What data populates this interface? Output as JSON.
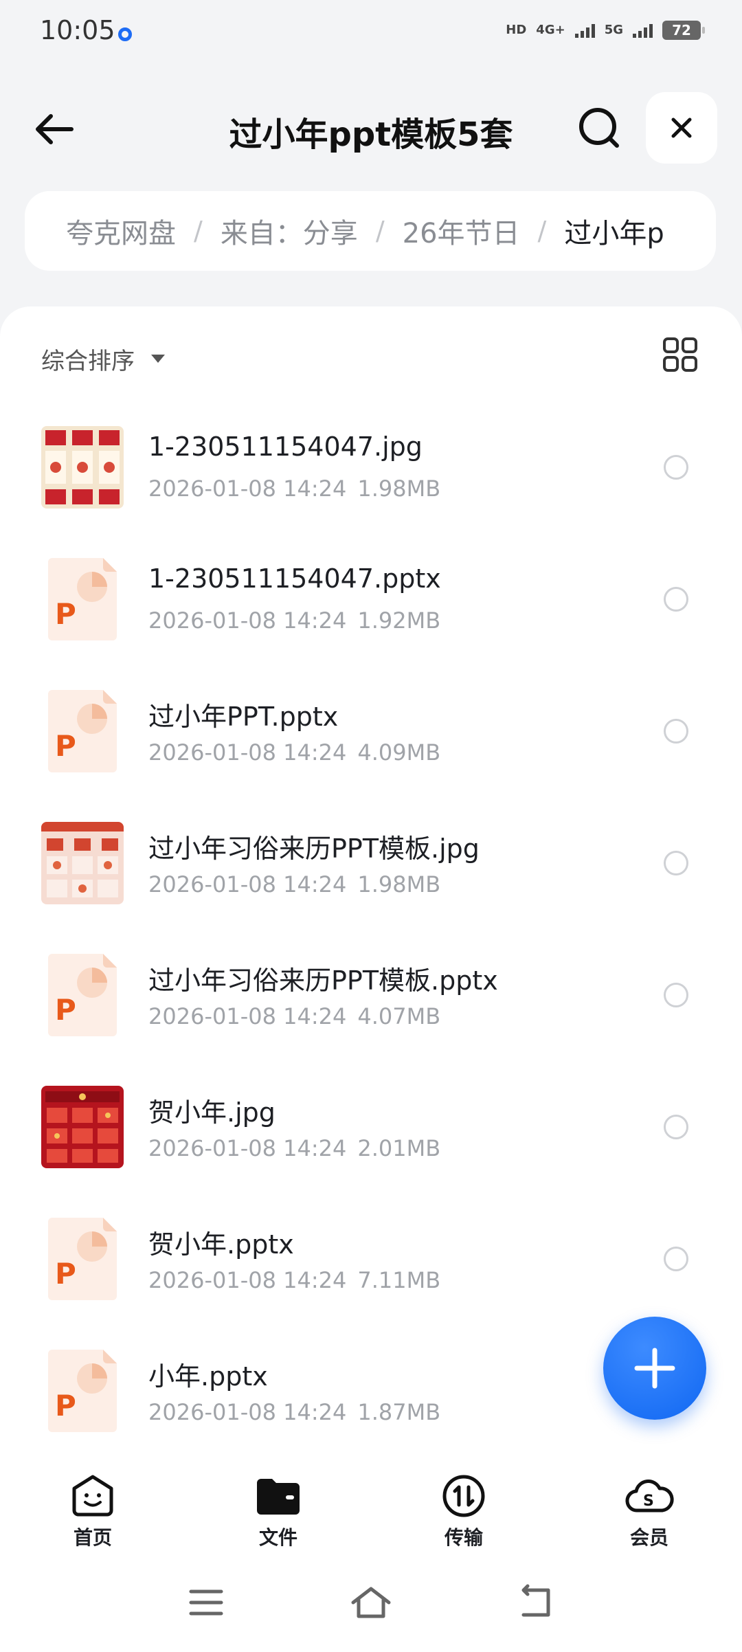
{
  "status": {
    "time": "10:05",
    "hd": "HD",
    "net1": "4G+",
    "net2": "5G",
    "battery": "72"
  },
  "header": {
    "title": "过小年ppt模板5套"
  },
  "breadcrumb": {
    "items": [
      "夸克网盘",
      "来自：分享",
      "26年节日",
      "过小年p"
    ]
  },
  "sort": {
    "label": "综合排序"
  },
  "files": [
    {
      "name": "1-230511154047.jpg",
      "date": "2026-01-08 14:24",
      "size": "1.98MB",
      "type": "jpg"
    },
    {
      "name": "1-230511154047.pptx",
      "date": "2026-01-08 14:24",
      "size": "1.92MB",
      "type": "pptx"
    },
    {
      "name": "过小年PPT.pptx",
      "date": "2026-01-08 14:24",
      "size": "4.09MB",
      "type": "pptx"
    },
    {
      "name": "过小年习俗来历PPT模板.jpg",
      "date": "2026-01-08 14:24",
      "size": "1.98MB",
      "type": "jpg"
    },
    {
      "name": "过小年习俗来历PPT模板.pptx",
      "date": "2026-01-08 14:24",
      "size": "4.07MB",
      "type": "pptx"
    },
    {
      "name": "贺小年.jpg",
      "date": "2026-01-08 14:24",
      "size": "2.01MB",
      "type": "jpg"
    },
    {
      "name": "贺小年.pptx",
      "date": "2026-01-08 14:24",
      "size": "7.11MB",
      "type": "pptx"
    },
    {
      "name": "小年.pptx",
      "date": "2026-01-08 14:24",
      "size": "1.87MB",
      "type": "pptx"
    }
  ],
  "tabs": [
    {
      "label": "首页",
      "icon": "home-face-icon"
    },
    {
      "label": "文件",
      "icon": "folder-icon"
    },
    {
      "label": "传输",
      "icon": "transfer-icon"
    },
    {
      "label": "会员",
      "icon": "vip-cloud-icon"
    }
  ],
  "colors": {
    "accent": "#1067f2",
    "ppt": "#e8591a"
  }
}
